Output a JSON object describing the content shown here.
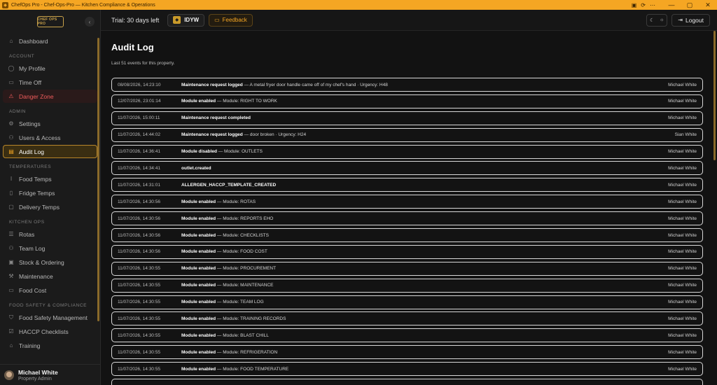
{
  "window": {
    "title": "ChefOps Pro - Chef-Ops-Pro — Kitchen Compliance & Operations",
    "minimize": "—",
    "maximize": "▢",
    "close": "✕"
  },
  "sidebar": {
    "logo_text": "CHEF OPS PRO",
    "collapse_icon": "‹",
    "dashboard": "Dashboard",
    "sections": {
      "account": "ACCOUNT",
      "admin": "ADMIN",
      "temperatures": "TEMPERATURES",
      "kitchen_ops": "KITCHEN OPS",
      "food_safety": "FOOD SAFETY & COMPLIANCE"
    },
    "items": {
      "my_profile": "My Profile",
      "time_off": "Time Off",
      "danger_zone": "Danger Zone",
      "settings": "Settings",
      "users_access": "Users & Access",
      "audit_log": "Audit Log",
      "food_temps": "Food Temps",
      "fridge_temps": "Fridge Temps",
      "delivery_temps": "Delivery Temps",
      "rotas": "Rotas",
      "team_log": "Team Log",
      "stock_ordering": "Stock & Ordering",
      "maintenance": "Maintenance",
      "food_cost": "Food Cost",
      "food_safety_management": "Food Safety Management",
      "haccp_checklists": "HACCP Checklists",
      "training": "Training"
    },
    "user": {
      "name": "Michael White",
      "role": "Property Admin"
    }
  },
  "topbar": {
    "trial": "Trial: 30 days left",
    "property_code": "IDYW",
    "feedback": "Feedback",
    "logout": "Logout"
  },
  "main": {
    "title": "Audit Log",
    "subtitle": "Last 51 events for this property.",
    "rows": [
      {
        "ts": "08/08/2026, 14:23:10",
        "action": "Maintenance request logged",
        "detail": " — A metal fryer door handle came off of my chef's hand · Urgency: H48",
        "user": "Michael White"
      },
      {
        "ts": "12/07/2026, 23:01:14",
        "action": "Module enabled",
        "detail": " — Module: RIGHT TO WORK",
        "user": "Michael White"
      },
      {
        "ts": "11/07/2026, 15:00:11",
        "action": "Maintenance request completed",
        "detail": "",
        "user": "Michael White"
      },
      {
        "ts": "11/07/2026, 14:44:02",
        "action": "Maintenance request logged",
        "detail": " — door broken · Urgency: H24",
        "user": "Sian White"
      },
      {
        "ts": "11/07/2026, 14:36:41",
        "action": "Module disabled",
        "detail": " — Module: OUTLETS",
        "user": "Michael White"
      },
      {
        "ts": "11/07/2026, 14:34:41",
        "action": "outlet.created",
        "detail": "",
        "user": "Michael White"
      },
      {
        "ts": "11/07/2026, 14:31:01",
        "action": "ALLERGEN_HACCP_TEMPLATE_CREATED",
        "detail": "",
        "user": "Michael White"
      },
      {
        "ts": "11/07/2026, 14:30:56",
        "action": "Module enabled",
        "detail": " — Module: ROTAS",
        "user": "Michael White"
      },
      {
        "ts": "11/07/2026, 14:30:56",
        "action": "Module enabled",
        "detail": " — Module: REPORTS EHO",
        "user": "Michael White"
      },
      {
        "ts": "11/07/2026, 14:30:56",
        "action": "Module enabled",
        "detail": " — Module: CHECKLISTS",
        "user": "Michael White"
      },
      {
        "ts": "11/07/2026, 14:30:56",
        "action": "Module enabled",
        "detail": " — Module: FOOD COST",
        "user": "Michael White"
      },
      {
        "ts": "11/07/2026, 14:30:55",
        "action": "Module enabled",
        "detail": " — Module: PROCUREMENT",
        "user": "Michael White"
      },
      {
        "ts": "11/07/2026, 14:30:55",
        "action": "Module enabled",
        "detail": " — Module: MAINTENANCE",
        "user": "Michael White"
      },
      {
        "ts": "11/07/2026, 14:30:55",
        "action": "Module enabled",
        "detail": " — Module: TEAM LOG",
        "user": "Michael White"
      },
      {
        "ts": "11/07/2026, 14:30:55",
        "action": "Module enabled",
        "detail": " — Module: TRAINING RECORDS",
        "user": "Michael White"
      },
      {
        "ts": "11/07/2026, 14:30:55",
        "action": "Module enabled",
        "detail": " — Module: BLAST CHILL",
        "user": "Michael White"
      },
      {
        "ts": "11/07/2026, 14:30:55",
        "action": "Module enabled",
        "detail": " — Module: REFRIGERATION",
        "user": "Michael White"
      },
      {
        "ts": "11/07/2026, 14:30:55",
        "action": "Module enabled",
        "detail": " — Module: FOOD TEMPERATURE",
        "user": "Michael White"
      },
      {
        "ts": "",
        "action": "",
        "detail": "",
        "user": ""
      }
    ]
  },
  "icons": {
    "dashboard": "home-icon",
    "my_profile": "user-icon",
    "time_off": "calendar-icon",
    "danger_zone": "warning-icon",
    "settings": "gear-icon",
    "users_access": "users-icon",
    "audit_log": "document-icon",
    "food_temps": "thermometer-icon",
    "fridge_temps": "fridge-icon",
    "delivery_temps": "box-icon",
    "rotas": "list-icon",
    "team_log": "team-icon",
    "stock_ordering": "package-icon",
    "maintenance": "wrench-icon",
    "food_cost": "card-icon",
    "food_safety_management": "shield-icon",
    "haccp_checklists": "checklist-icon",
    "training": "graduation-icon"
  },
  "colors": {
    "titlebar": "#f5a623",
    "accent": "#f5a623",
    "danger": "#ef5b5b",
    "background": "#121212",
    "row_border": "#d8d8d8"
  }
}
